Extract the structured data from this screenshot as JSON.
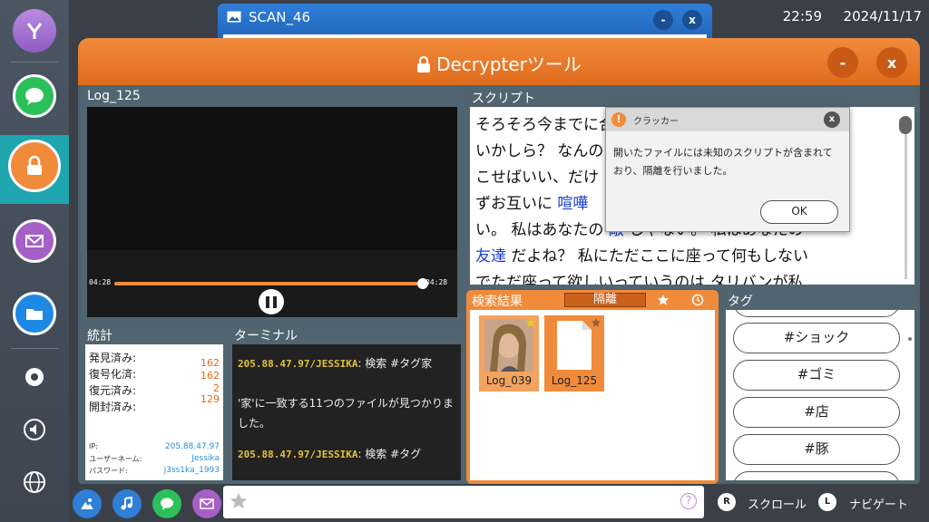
{
  "status_bar": {
    "time": "22:59",
    "date": "2024/11/17"
  },
  "scan_window": {
    "title": "SCAN_46",
    "minimize": "-",
    "close": "x"
  },
  "decrypter": {
    "title": "Decrypterツール",
    "minimize": "-",
    "close": "x",
    "colors": {
      "accent": "#f08b3b",
      "panel": "#50656f"
    }
  },
  "log_panel": {
    "title": "Log_125",
    "time_current": "04:28",
    "time_total": "04:28",
    "progress": 1.0
  },
  "script_panel": {
    "title": "スクリプト",
    "lines": [
      [
        {
          "t": "そろそろ今までに",
          "hl": false
        },
        {
          "t": "",
          "hl": false
        },
        {
          "t": "合",
          "hl": false
        }
      ],
      [
        {
          "t": "いかしら？ なんの",
          "hl": false
        }
      ],
      [
        {
          "t": "こせばいい、だけ",
          "hl": false
        }
      ],
      [
        {
          "t": "ずお互いに ",
          "hl": false
        },
        {
          "t": "喧嘩",
          "hl": true
        }
      ],
      [
        {
          "t": "い。 私はあなたの ",
          "hl": false
        },
        {
          "t": "敵",
          "hl": true
        },
        {
          "t": " じゃない。 私はあなたの",
          "hl": false
        }
      ],
      [
        {
          "t": "友達",
          "hl": true
        },
        {
          "t": " だよね？ 私にただここに座って何もしない",
          "hl": false
        }
      ],
      [
        {
          "t": "でただ座って欲しいっていうのは タリバンが私",
          "hl": false
        }
      ]
    ]
  },
  "dialog": {
    "title": "クラッカー",
    "message": "開いたファイルには未知のスクリプトが含まれており、隔離を行いました。",
    "ok": "OK",
    "close": "x",
    "warn": "!"
  },
  "results_panel": {
    "title": "検索結果",
    "tab": "隔離",
    "items": [
      {
        "label": "Log_039",
        "icon": "photo-thumbnail",
        "starred": true
      },
      {
        "label": "Log_125",
        "icon": "document-icon",
        "starred": false
      }
    ]
  },
  "tag_panel": {
    "title": "タグ",
    "tags": [
      "#ショック",
      "#ゴミ",
      "#店",
      "#豚"
    ]
  },
  "stats_panel": {
    "title": "統計",
    "rows": [
      {
        "label": "発見済み:",
        "value": "162"
      },
      {
        "label": "復号化済:",
        "value": "162"
      },
      {
        "label": "復元済み:",
        "value": "2"
      },
      {
        "label": "開封済み:",
        "value": "129"
      }
    ],
    "info": [
      {
        "label": "IP:",
        "value": "205.88.47.97"
      },
      {
        "label": "ユーザーネーム:",
        "value": "Jessika"
      },
      {
        "label": "パスワード:",
        "value": "j3ss1ka_1993"
      }
    ]
  },
  "terminal_panel": {
    "title": "ターミナル",
    "prompt1": "205.88.47.97/JESSIKA",
    "command1": ": 検索 #タグ家",
    "output": "'家'に一致する11つのファイルが見つかりました。",
    "prompt2": "205.88.47.97/JESSIKA",
    "command2": ": 検索 #タグ"
  },
  "bottom_bar": {
    "help": "?",
    "hint1_key": "R",
    "hint1_label": "スクロール",
    "hint2_key": "L",
    "hint2_label": "ナビゲート"
  }
}
